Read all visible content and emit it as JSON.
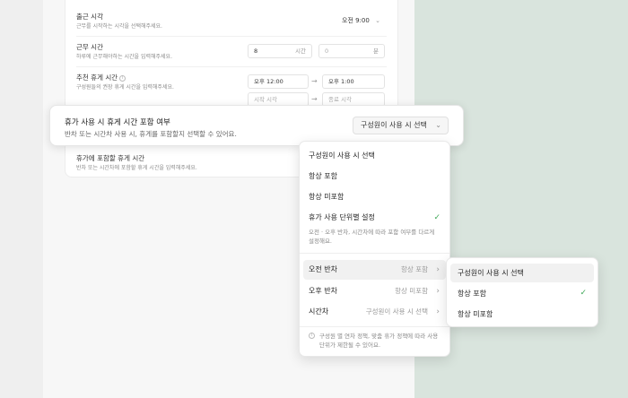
{
  "settings": {
    "clock_in": {
      "title": "출근 시각",
      "desc": "근무를 시작하는 시각을 선택해주세요.",
      "value": "오전 9:00"
    },
    "work_time": {
      "title": "근무 시간",
      "desc": "하루에 근무해야하는 시간을 입력해주세요.",
      "hours_value": "8",
      "hours_unit": "시간",
      "minutes_value": "0",
      "minutes_unit": "분"
    },
    "break_time": {
      "title": "추천 휴게 시간",
      "desc": "구성원들의 권장 휴게 시간을 입력해주세요.",
      "start": "오후 12:00",
      "end": "오후 1:00",
      "start_placeholder": "시작 시각",
      "end_placeholder": "종료 시각"
    },
    "leave_break": {
      "title": "휴가에 포함할 휴게 시간",
      "desc": "반차 또는 시간차에 포함할 휴게 시간을 입력해주세요."
    }
  },
  "highlight": {
    "title": "휴가 사용 시 휴게 시간 포함 여부",
    "desc": "반차 또는 시간차 사용 시, 휴게를 포함할지 선택할 수 있어요.",
    "selected": "구성원이 사용 시 선택"
  },
  "dropdown": {
    "options": [
      "구성원이 사용 시 선택",
      "항상 포함",
      "항상 미포함",
      "휴가 사용 단위별 설정"
    ],
    "unit_desc": "오전 · 오후 반차, 시간차에 따라 포함 여부를 다르게 설정해요.",
    "units": [
      {
        "label": "오전 반차",
        "value": "항상 포함"
      },
      {
        "label": "오후 반차",
        "value": "항상 미포함"
      },
      {
        "label": "시간차",
        "value": "구성원이 사용 시 선택"
      }
    ],
    "footer": "구성원 별 연차 정책, 맞춤 휴가 정책에 따라 사용 단위가 제한될 수 있어요."
  },
  "submenu": {
    "options": [
      "구성원이 사용 시 선택",
      "항상 포함",
      "항상 미포함"
    ]
  },
  "colors": {
    "check": "#3fa857",
    "background": "#d8e3dd"
  }
}
